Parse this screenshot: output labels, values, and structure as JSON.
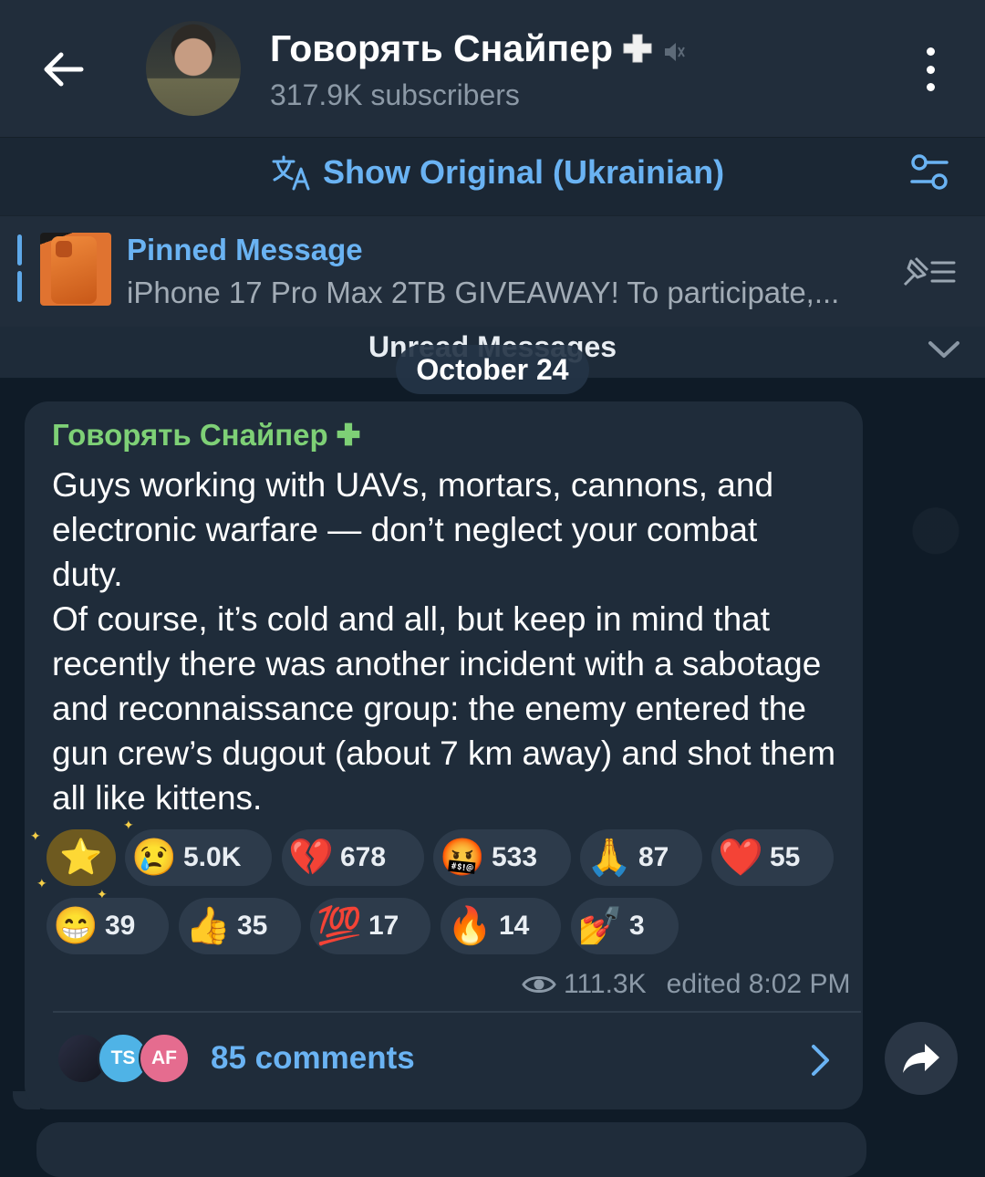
{
  "header": {
    "channel_name": "Говорять Снайпер",
    "subscribers": "317.9K subscribers",
    "back_icon": "arrow-left-icon",
    "menu_icon": "more-vertical-icon"
  },
  "translate": {
    "label": "Show Original (Ukrainian)",
    "icon": "translate-icon",
    "settings_icon": "sliders-icon"
  },
  "pinned": {
    "title": "Pinned Message",
    "text": "iPhone 17 Pro Max 2TB GIVEAWAY! To participate,...",
    "icon": "pinned-list-icon"
  },
  "unread": {
    "label": "Unread Messages"
  },
  "date_pill": "October 24",
  "message": {
    "sender": "Говорять Снайпер",
    "paragraphs": [
      "Guys working with UAVs, mortars, cannons, and electronic warfare — don’t neglect your combat duty.",
      "Of course, it’s cold and all, but keep in mind that recently there was another incident with a sabotage and reconnaissance group: the enemy entered the gun crew’s dugout (about 7 km away) and shot them all like kittens."
    ],
    "reactions": [
      {
        "emoji": "😢",
        "count": "5.0K"
      },
      {
        "emoji": "💔",
        "count": "678"
      },
      {
        "emoji": "🤬",
        "count": "533"
      },
      {
        "emoji": "🙏",
        "count": "87"
      },
      {
        "emoji": "❤️",
        "count": "55"
      },
      {
        "emoji": "😁",
        "count": "39"
      },
      {
        "emoji": "👍",
        "count": "35"
      },
      {
        "emoji": "💯",
        "count": "17"
      },
      {
        "emoji": "🔥",
        "count": "14"
      },
      {
        "emoji": "💅",
        "count": "3"
      }
    ],
    "star_reaction": "⭐",
    "views": "111.3K",
    "edited": "edited 8:02 PM"
  },
  "comments": {
    "label": "85 comments",
    "avatars": [
      "",
      "TS",
      "AF"
    ]
  },
  "colors": {
    "accent": "#6ab3f3",
    "sender": "#7ed076",
    "bubble": "#1f2c3a",
    "header": "#212d3b"
  }
}
